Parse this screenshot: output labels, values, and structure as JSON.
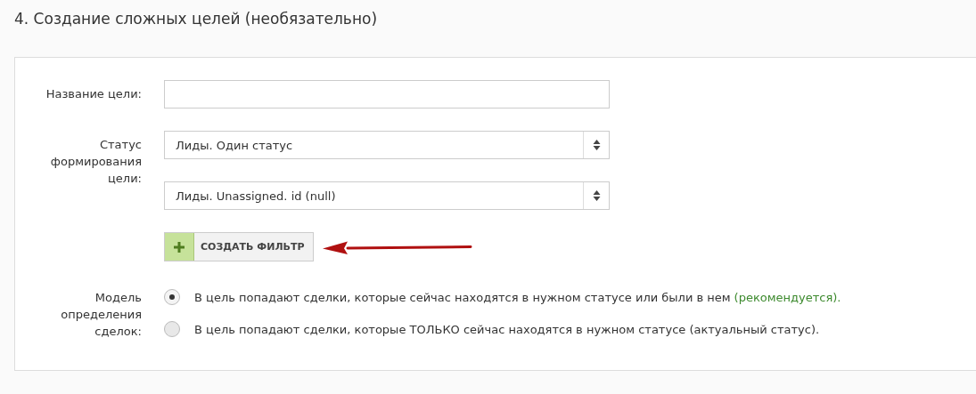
{
  "heading": "4. Создание сложных целей (необязательно)",
  "form": {
    "fields": [
      {
        "kind": "text",
        "label": "Название цели:"
      },
      {
        "kind": "selects",
        "label": "Статус формирования цели:",
        "selects": [
          "Лиды. Один статус",
          "Лиды. Unassigned. id (null)"
        ],
        "button": "СОЗДАТЬ ФИЛЬТР"
      },
      {
        "kind": "radios",
        "label": "Модель определения сделок:",
        "options": [
          {
            "text": "В цель попадают сделки, которые сейчас находятся в нужном статусе или были в нем",
            "note": "(рекомендуется).",
            "selected": true
          },
          {
            "text": "В цель попадают сделки, которые ТОЛЬКО сейчас находятся в нужном статусе (актуальный статус).",
            "selected": false
          }
        ]
      }
    ]
  }
}
